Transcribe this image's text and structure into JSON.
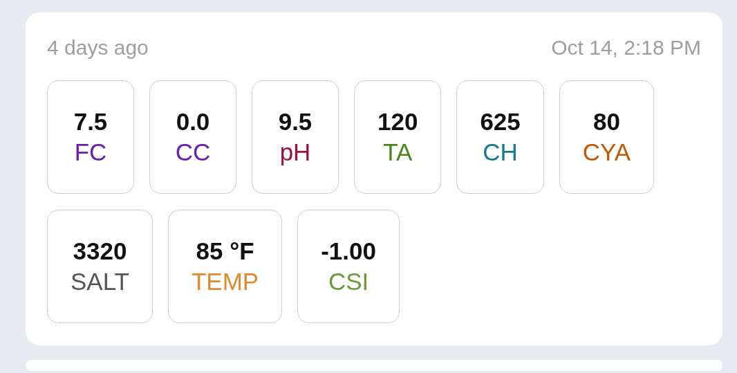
{
  "card": {
    "relative_time": "4 days ago",
    "timestamp": "Oct 14, 2:18 PM",
    "rows": [
      {
        "readings": [
          {
            "value": "7.5",
            "label": "FC",
            "color": "#6a1fb0"
          },
          {
            "value": "0.0",
            "label": "CC",
            "color": "#6a1fb0"
          },
          {
            "value": "9.5",
            "label": "pH",
            "color": "#a0103c"
          },
          {
            "value": "120",
            "label": "TA",
            "color": "#4a861c"
          },
          {
            "value": "625",
            "label": "CH",
            "color": "#18788e"
          },
          {
            "value": "80",
            "label": "CYA",
            "color": "#c05a08"
          }
        ]
      },
      {
        "readings": [
          {
            "value": "3320",
            "label": "SALT",
            "color": "#555555"
          },
          {
            "value": "85 °F",
            "label": "TEMP",
            "color": "#e08a30"
          },
          {
            "value": "-1.00",
            "label": "CSI",
            "color": "#6a9a3a"
          }
        ]
      }
    ]
  }
}
